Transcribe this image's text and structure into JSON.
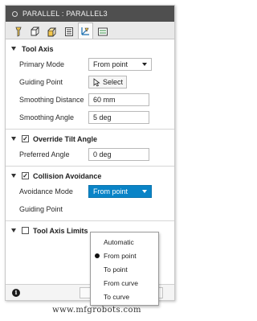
{
  "window": {
    "title": "PARALLEL : PARALLEL3"
  },
  "tabs": [
    {
      "icon": "tool-icon"
    },
    {
      "icon": "geometry-icon"
    },
    {
      "icon": "heights-icon"
    },
    {
      "icon": "passes-icon"
    },
    {
      "icon": "multi-axis-icon",
      "active": true
    },
    {
      "icon": "linking-icon"
    }
  ],
  "tool_axis": {
    "header": "Tool Axis",
    "primary_mode_label": "Primary Mode",
    "primary_mode_value": "From point",
    "guiding_point_label": "Guiding Point",
    "select_label": "Select",
    "smoothing_distance_label": "Smoothing Distance",
    "smoothing_distance_value": "60 mm",
    "smoothing_angle_label": "Smoothing Angle",
    "smoothing_angle_value": "5 deg"
  },
  "override_tilt": {
    "header": "Override Tilt Angle",
    "checked": true,
    "preferred_angle_label": "Preferred Angle",
    "preferred_angle_value": "0 deg"
  },
  "collision": {
    "header": "Collision Avoidance",
    "checked": true,
    "avoidance_mode_label": "Avoidance Mode",
    "avoidance_mode_value": "From point",
    "guiding_point_label": "Guiding Point"
  },
  "avoidance_menu": {
    "options": [
      "Automatic",
      "From point",
      "To point",
      "From curve",
      "To curve"
    ],
    "selected": "From point"
  },
  "tool_axis_limits": {
    "header": "Tool Axis Limits",
    "checked": false
  },
  "footer": {
    "info_glyph": "i"
  },
  "watermark": "www.mfgrobots.com",
  "colors": {
    "titlebar": "#4f4f4f",
    "accent": "#0a84c7"
  }
}
